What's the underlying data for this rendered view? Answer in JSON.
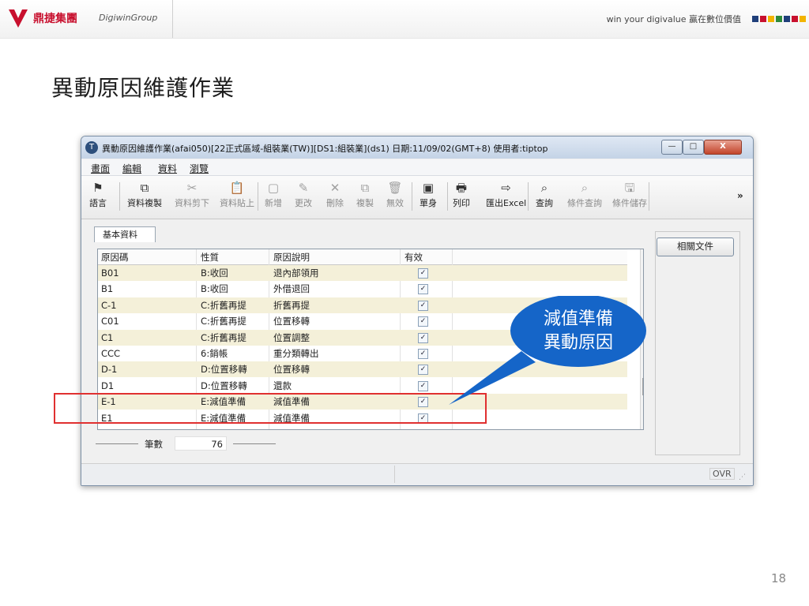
{
  "header": {
    "brand_cn": "鼎捷集團",
    "brand_en": "DigiwinGroup",
    "slogan": "win your digivalue 贏在數位價值",
    "colors": [
      "#1f3f7a",
      "#c8102e",
      "#f2b400",
      "#2e8b3a",
      "#1f3f7a",
      "#c8102e",
      "#f2b400"
    ]
  },
  "slide": {
    "title": "異動原因維護作業",
    "page_number": "18"
  },
  "window": {
    "title": "異動原因維護作業(afai050)[22正式區域-組裝業(TW)][DS1:組裝業](ds1) 日期:11/09/02(GMT+8) 使用者:tiptop",
    "controls": {
      "minimize": "—",
      "maximize": "□",
      "close": "X"
    }
  },
  "menu": [
    "畫面",
    "編輯",
    "資料",
    "瀏覽"
  ],
  "toolbar": [
    {
      "label": "語言",
      "icon": "flag-icon",
      "glyph": "⚑",
      "disabled": false
    },
    {
      "label": "資料複製",
      "icon": "copy-data-icon",
      "glyph": "⧉",
      "disabled": false
    },
    {
      "label": "資料剪下",
      "icon": "scissors-icon",
      "glyph": "✂",
      "disabled": true
    },
    {
      "label": "資料貼上",
      "icon": "paste-icon",
      "glyph": "📋",
      "disabled": true
    },
    {
      "label": "新增",
      "icon": "new-document-icon",
      "glyph": "▢",
      "disabled": true
    },
    {
      "label": "更改",
      "icon": "pencil-icon",
      "glyph": "✎",
      "disabled": true
    },
    {
      "label": "刪除",
      "icon": "delete-x-icon",
      "glyph": "✕",
      "disabled": true
    },
    {
      "label": "複製",
      "icon": "duplicate-icon",
      "glyph": "⧉",
      "disabled": true
    },
    {
      "label": "無效",
      "icon": "trash-icon",
      "glyph": "🗑",
      "disabled": true
    },
    {
      "label": "單身",
      "icon": "detail-icon",
      "glyph": "▣",
      "disabled": false
    },
    {
      "label": "列印",
      "icon": "printer-icon",
      "glyph": "🖶",
      "disabled": false
    },
    {
      "label": "匯出Excel",
      "icon": "export-excel-icon",
      "glyph": "⇨",
      "disabled": false
    },
    {
      "label": "查詢",
      "icon": "binoculars-icon",
      "glyph": "⌕",
      "disabled": false
    },
    {
      "label": "條件查詢",
      "icon": "conditional-query-icon",
      "glyph": "⌕",
      "disabled": true
    },
    {
      "label": "條件儲存",
      "icon": "save-condition-icon",
      "glyph": "🖫",
      "disabled": true
    }
  ],
  "toolbar_more": "»",
  "tab": "基本資料",
  "table": {
    "columns": [
      "原因碼",
      "性質",
      "原因說明",
      "有效"
    ],
    "rows": [
      {
        "code": "B01",
        "type": "B:收回",
        "desc": "退內部領用",
        "valid": "✓"
      },
      {
        "code": "B1",
        "type": "B:收回",
        "desc": "外借退回",
        "valid": "✓"
      },
      {
        "code": "C-1",
        "type": "C:折舊再提",
        "desc": "折舊再提",
        "valid": "✓"
      },
      {
        "code": "C01",
        "type": "C:折舊再提",
        "desc": "位置移轉",
        "valid": "✓"
      },
      {
        "code": "C1",
        "type": "C:折舊再提",
        "desc": "位置調整",
        "valid": "✓"
      },
      {
        "code": "CCC",
        "type": "6:銷帳",
        "desc": "重分類轉出",
        "valid": "✓"
      },
      {
        "code": "D-1",
        "type": "D:位置移轉",
        "desc": "位置移轉",
        "valid": "✓"
      },
      {
        "code": "D1",
        "type": "D:位置移轉",
        "desc": "還款",
        "valid": "✓"
      },
      {
        "code": "E-1",
        "type": "E:減值準備",
        "desc": "減值準備",
        "valid": "✓"
      },
      {
        "code": "E1",
        "type": "E:減值準備",
        "desc": "減值準備",
        "valid": "✓"
      }
    ]
  },
  "related_docs": "相關文件",
  "count": {
    "label": "筆數",
    "value": "76"
  },
  "status": {
    "mode": "OVR"
  },
  "callout": {
    "line1": "減值準備",
    "line2": "異動原因",
    "color": "#1565c8"
  }
}
